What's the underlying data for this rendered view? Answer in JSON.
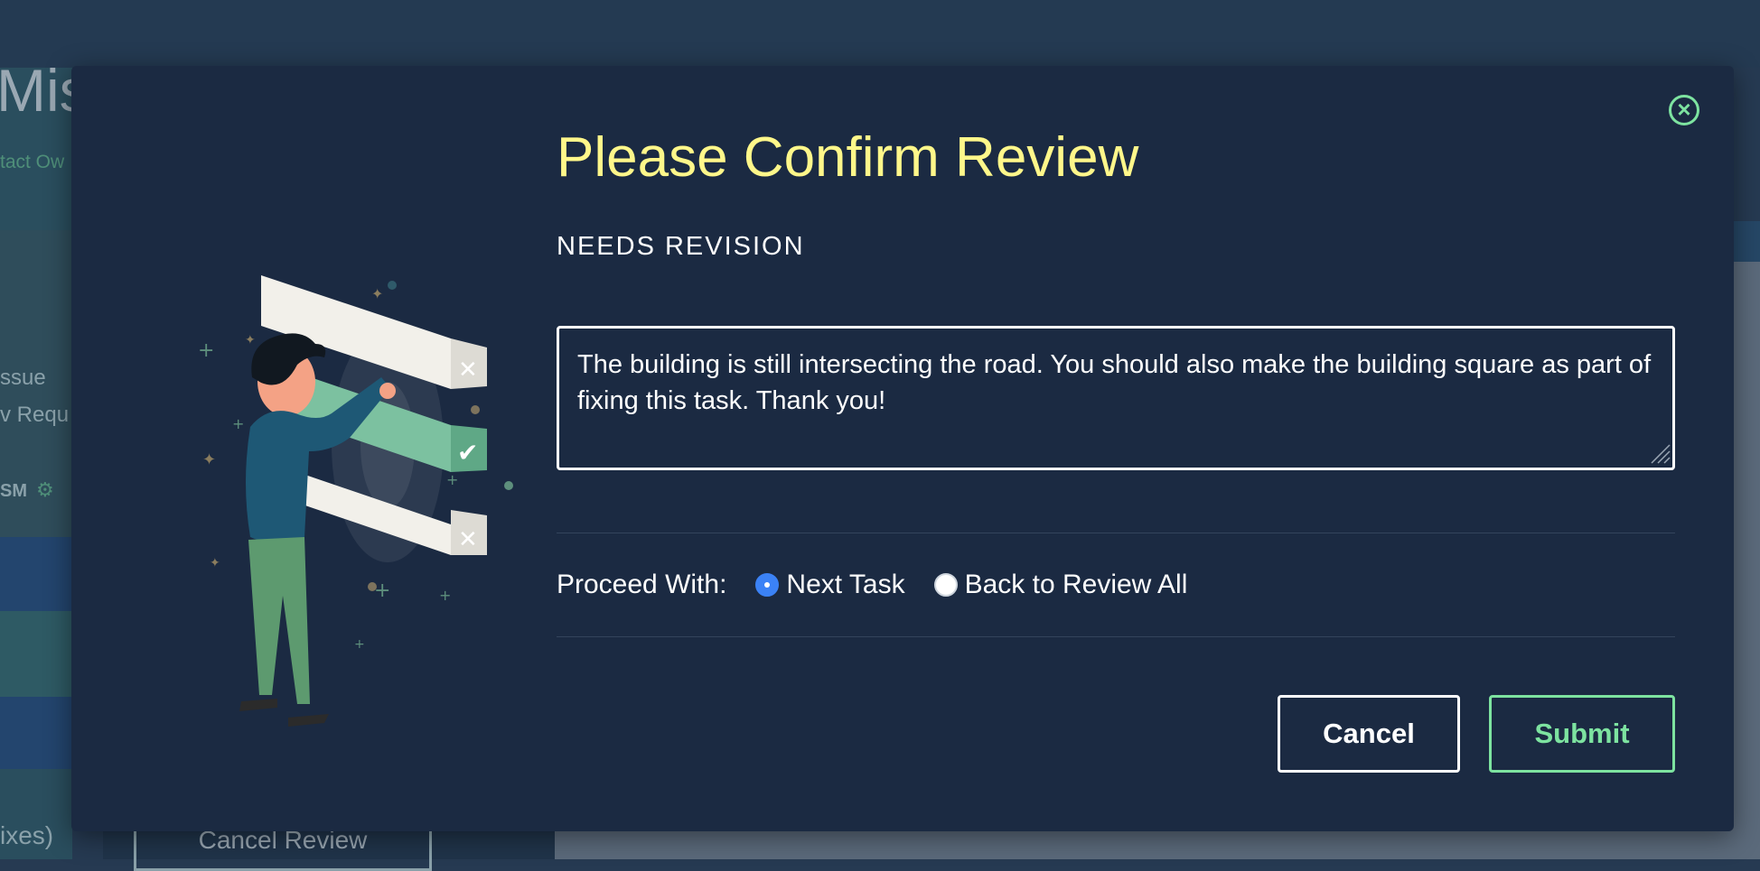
{
  "background": {
    "title_fragment": "Mis",
    "subtitle_fragment": "tact Ow",
    "line1": "ssue",
    "line2": "v Requ",
    "osm_label": "SM",
    "fixes_fragment": "ixes)",
    "cancel_review_label": "Cancel Review"
  },
  "modal": {
    "title": "Please Confirm Review",
    "status": "NEEDS REVISION",
    "comment": "The building is still intersecting the road. You should also make the building square as part of fixing this task. Thank you!",
    "proceed": {
      "label": "Proceed With:",
      "options": [
        {
          "label": "Next Task",
          "selected": true
        },
        {
          "label": "Back to Review All",
          "selected": false
        }
      ]
    },
    "cancel_label": "Cancel",
    "submit_label": "Submit",
    "close_icon": "close-circle-icon"
  },
  "colors": {
    "modal_bg": "#1b2a42",
    "title": "#fff78a",
    "accent_green": "#7de3a0",
    "radio_selected": "#3b82f6"
  }
}
